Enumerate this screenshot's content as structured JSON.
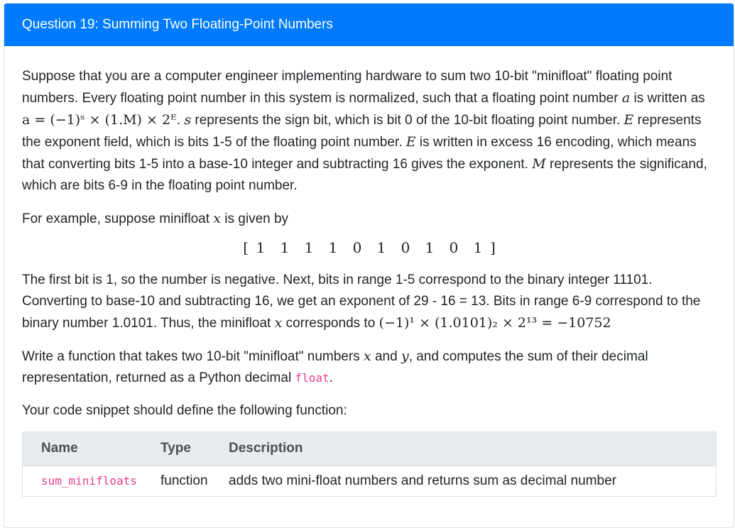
{
  "header": {
    "title": "Question 19: Summing Two Floating-Point Numbers"
  },
  "paragraphs": {
    "p1_a": "Suppose that you are a computer engineer implementing hardware to sum two 10-bit \"minifloat\" floating point numbers. Every floating point number in this system is normalized, such that a floating point number ",
    "p1_var_a": "a",
    "p1_b": " is written as ",
    "p1_formula": "a = (−1)ˢ × (1.M) × 2ᴱ",
    "p1_c": ". ",
    "p1_var_s": "s",
    "p1_d": " represents the sign bit, which is bit 0 of the 10-bit floating point number. ",
    "p1_var_E1": "E",
    "p1_e": " represents the exponent field, which is bits 1-5 of the floating point number. ",
    "p1_var_E2": "E",
    "p1_f": " is written in excess 16 encoding, which means that converting bits 1-5 into a base-10 integer and subtracting 16 gives the exponent. ",
    "p1_var_M": "M",
    "p1_g": " represents the significand, which are bits 6-9 in the floating point number.",
    "p2_a": "For example, suppose minifloat ",
    "p2_var_x": "x",
    "p2_b": " is given by",
    "bits": [
      "1",
      "1",
      "1",
      "1",
      "0",
      "1",
      "0",
      "1",
      "0",
      "1"
    ],
    "bracket_open": "[",
    "bracket_close": "]",
    "p3_a": "The first bit is 1, so the number is negative. Next, bits in range 1-5 correspond to the binary integer 11101. Converting to base-10 and subtracting 16, we get an exponent of 29 - 16 = 13. Bits in range 6-9 correspond to the binary number 1.0101. Thus, the minifloat ",
    "p3_var_x": "x",
    "p3_b": " corresponds to ",
    "p3_formula": "(−1)¹ × (1.0101)₂ × 2¹³ = −10752",
    "p4_a": "Write a function that takes two 10-bit \"minifloat\" numbers ",
    "p4_var_x": "x",
    "p4_b": " and ",
    "p4_var_y": "y",
    "p4_c": ", and computes the sum of their decimal representation, returned as a Python decimal ",
    "p4_code": "float",
    "p4_d": ".",
    "p5": "Your code snippet should define the following function:"
  },
  "table": {
    "headers": [
      "Name",
      "Type",
      "Description"
    ],
    "rows": [
      {
        "name": "sum_minifloats",
        "type": "function",
        "description": "adds two mini-float numbers and returns sum as decimal number"
      }
    ]
  }
}
